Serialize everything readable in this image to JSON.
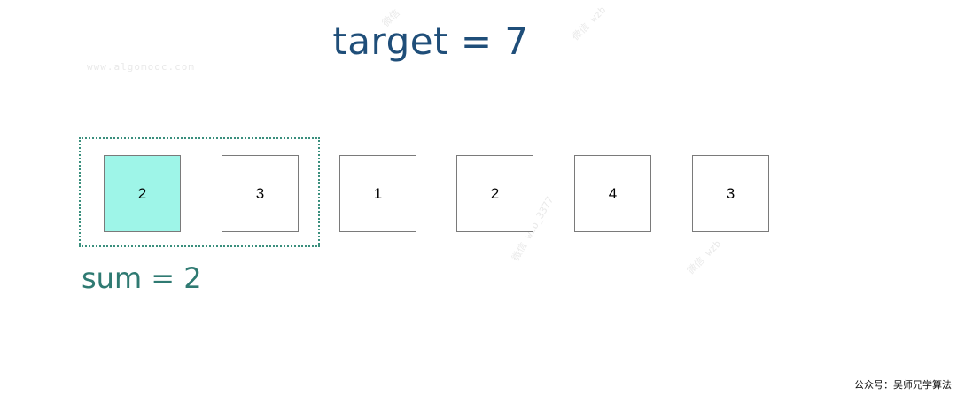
{
  "title": "target = 7",
  "array": {
    "values": [
      "2",
      "3",
      "1",
      "2",
      "4",
      "3"
    ],
    "window_start": 0,
    "window_end": 0
  },
  "sum_label": "sum = 2",
  "watermarks": [
    "www.algomooc.com",
    "微信",
    "微信 wzb",
    "微信 wzb_3377",
    "微信 wzb"
  ],
  "footer": "公众号：吴师兄学算法",
  "colors": {
    "title": "#1f4e79",
    "highlight": "#9ef5e8",
    "window_border": "#3a8f7d",
    "sum": "#2f7a72"
  }
}
